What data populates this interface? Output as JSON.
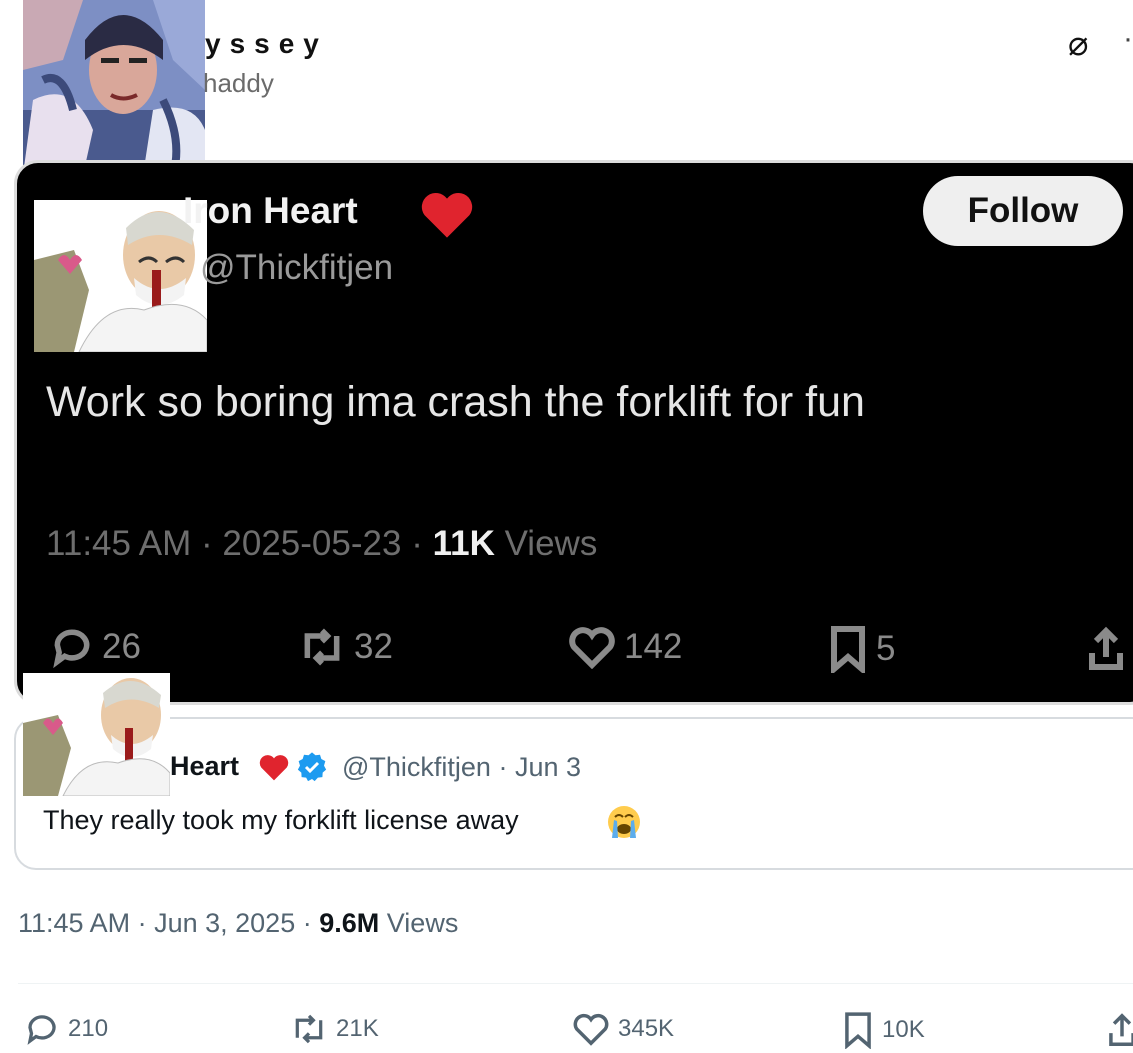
{
  "poster": {
    "name": "yssey",
    "handle": "haddy",
    "grok_icon": "grok-icon",
    "more_icon": "more-dots-icon"
  },
  "embedded_screenshot": {
    "display_name": "Iron Heart",
    "handle": "@Thickfitjen",
    "follow_label": "Follow",
    "text": "Work so boring ima crash the forklift for fun",
    "time": "11:45 AM",
    "date": "2025-05-23",
    "views_count": "11K",
    "views_label": "Views",
    "actions": {
      "replies": "26",
      "reposts": "32",
      "likes": "142",
      "bookmarks": "5"
    },
    "background": "#000000",
    "heart_color": "#e0242e"
  },
  "quoted_tweet": {
    "display_name": "Heart",
    "handle_date": "@Thickfitjen · Jun 3",
    "text": "They really took my forklift license away",
    "verified_color": "#1d9bf0",
    "heart_color": "#e0242e"
  },
  "main_tweet": {
    "time": "11:45 AM",
    "date": "Jun 3, 2025",
    "views_count": "9.6M",
    "views_label": "Views",
    "actions": {
      "replies": "210",
      "reposts": "21K",
      "likes": "345K",
      "bookmarks": "10K"
    }
  },
  "colors": {
    "text_primary": "#0f1419",
    "text_secondary": "#536471",
    "card_border": "#d7dbdf"
  }
}
